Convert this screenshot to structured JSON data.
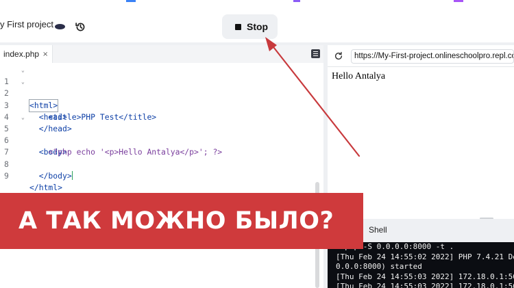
{
  "header": {
    "project_name": "y First project",
    "run_button_label": "Stop",
    "icons": {
      "project_avatar": "blob-icon",
      "history": "history-icon",
      "stop": "stop-square-icon"
    }
  },
  "editor": {
    "file_tab": {
      "label": "index.php",
      "close_glyph": "×"
    },
    "line_numbers": [
      "1",
      "2",
      "3",
      "4",
      "5",
      "6",
      "7",
      "8",
      "9"
    ],
    "lines": [
      "<html>",
      "  <head>",
      "    <title>PHP Test</title>",
      "  </head>",
      "  <body>",
      "    <?php echo '<p>Hello Antalya</p>'; ?>",
      "",
      "  </body>",
      "</html>"
    ],
    "fold_markers": [
      "⌄",
      "⌄",
      "",
      "",
      "⌄",
      "",
      "",
      "",
      ""
    ]
  },
  "webview": {
    "url": "https://My-First-project.onlineschoolpro.repl.co",
    "page_text": "Hello Antalya",
    "icons": {
      "refresh": "refresh-icon"
    }
  },
  "shell": {
    "tab_label": "Shell",
    "output_lines": [
      "php -S 0.0.0.0:8000 -t .",
      "[Thu Feb 24 14:55:02 2022] PHP 7.4.21 De",
      "0.0.0:8000) started",
      "[Thu Feb 24 14:55:03 2022] 172.18.0.1:56",
      "[Thu Feb 24 14:55:03 2022] 172.18.0.1:56"
    ]
  },
  "banner": {
    "text": "А ТАК МОЖНО БЫЛО?"
  },
  "colors": {
    "banner_bg": "#cf3a3c",
    "arrow": "#c83a3d",
    "console_bg": "#0b0d12",
    "tag_blue": "#0d3fa6",
    "php_purple": "#7a3e9d"
  }
}
